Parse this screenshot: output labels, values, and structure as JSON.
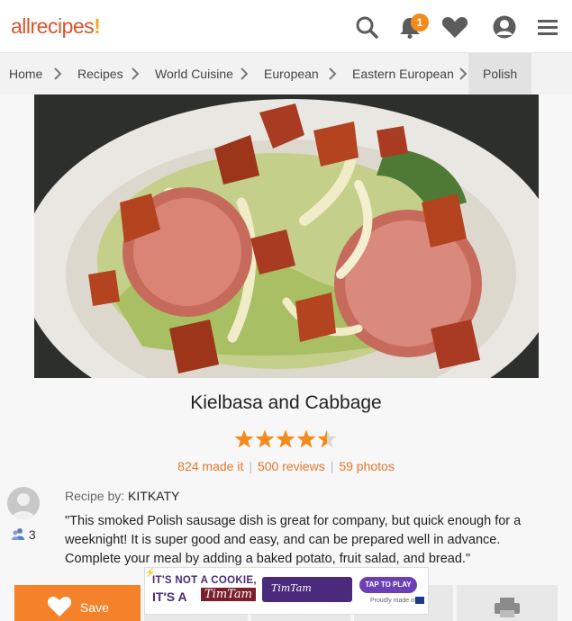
{
  "header": {
    "logo_text": "allrecipes",
    "logo_bang": "!",
    "notification_count": "1",
    "icons": [
      "search-icon",
      "bell-icon",
      "heart-icon",
      "user-icon",
      "menu-icon"
    ]
  },
  "breadcrumb": {
    "items": [
      "Home",
      "Recipes",
      "World Cuisine",
      "European",
      "Eastern European",
      "Polish"
    ]
  },
  "recipe": {
    "title": "Kielbasa and Cabbage",
    "rating": 4.5,
    "made_it": "824 made it",
    "reviews": "500 reviews",
    "photos": "59 photos",
    "byline_label": "Recipe by:",
    "author": "KITKATY",
    "followers": "3",
    "description": "\"This smoked Polish sausage dish is great for company, but quick enough for a weeknight! It is super good and easy, and can be prepared well in advance. Complete your meal by adding a baked potato, fruit salad, and bread.\""
  },
  "actions": {
    "save_label": "Save"
  },
  "ad": {
    "line1": "IT'S NOT A COOKIE,",
    "line2": "IT'S A",
    "brand": "TimTam",
    "pack": "TimTam",
    "cta": "TAP TO PLAY",
    "made": "Proudly made in"
  },
  "colors": {
    "accent": "#f5822a",
    "link": "#e8762c",
    "star": "#f28b1c"
  }
}
